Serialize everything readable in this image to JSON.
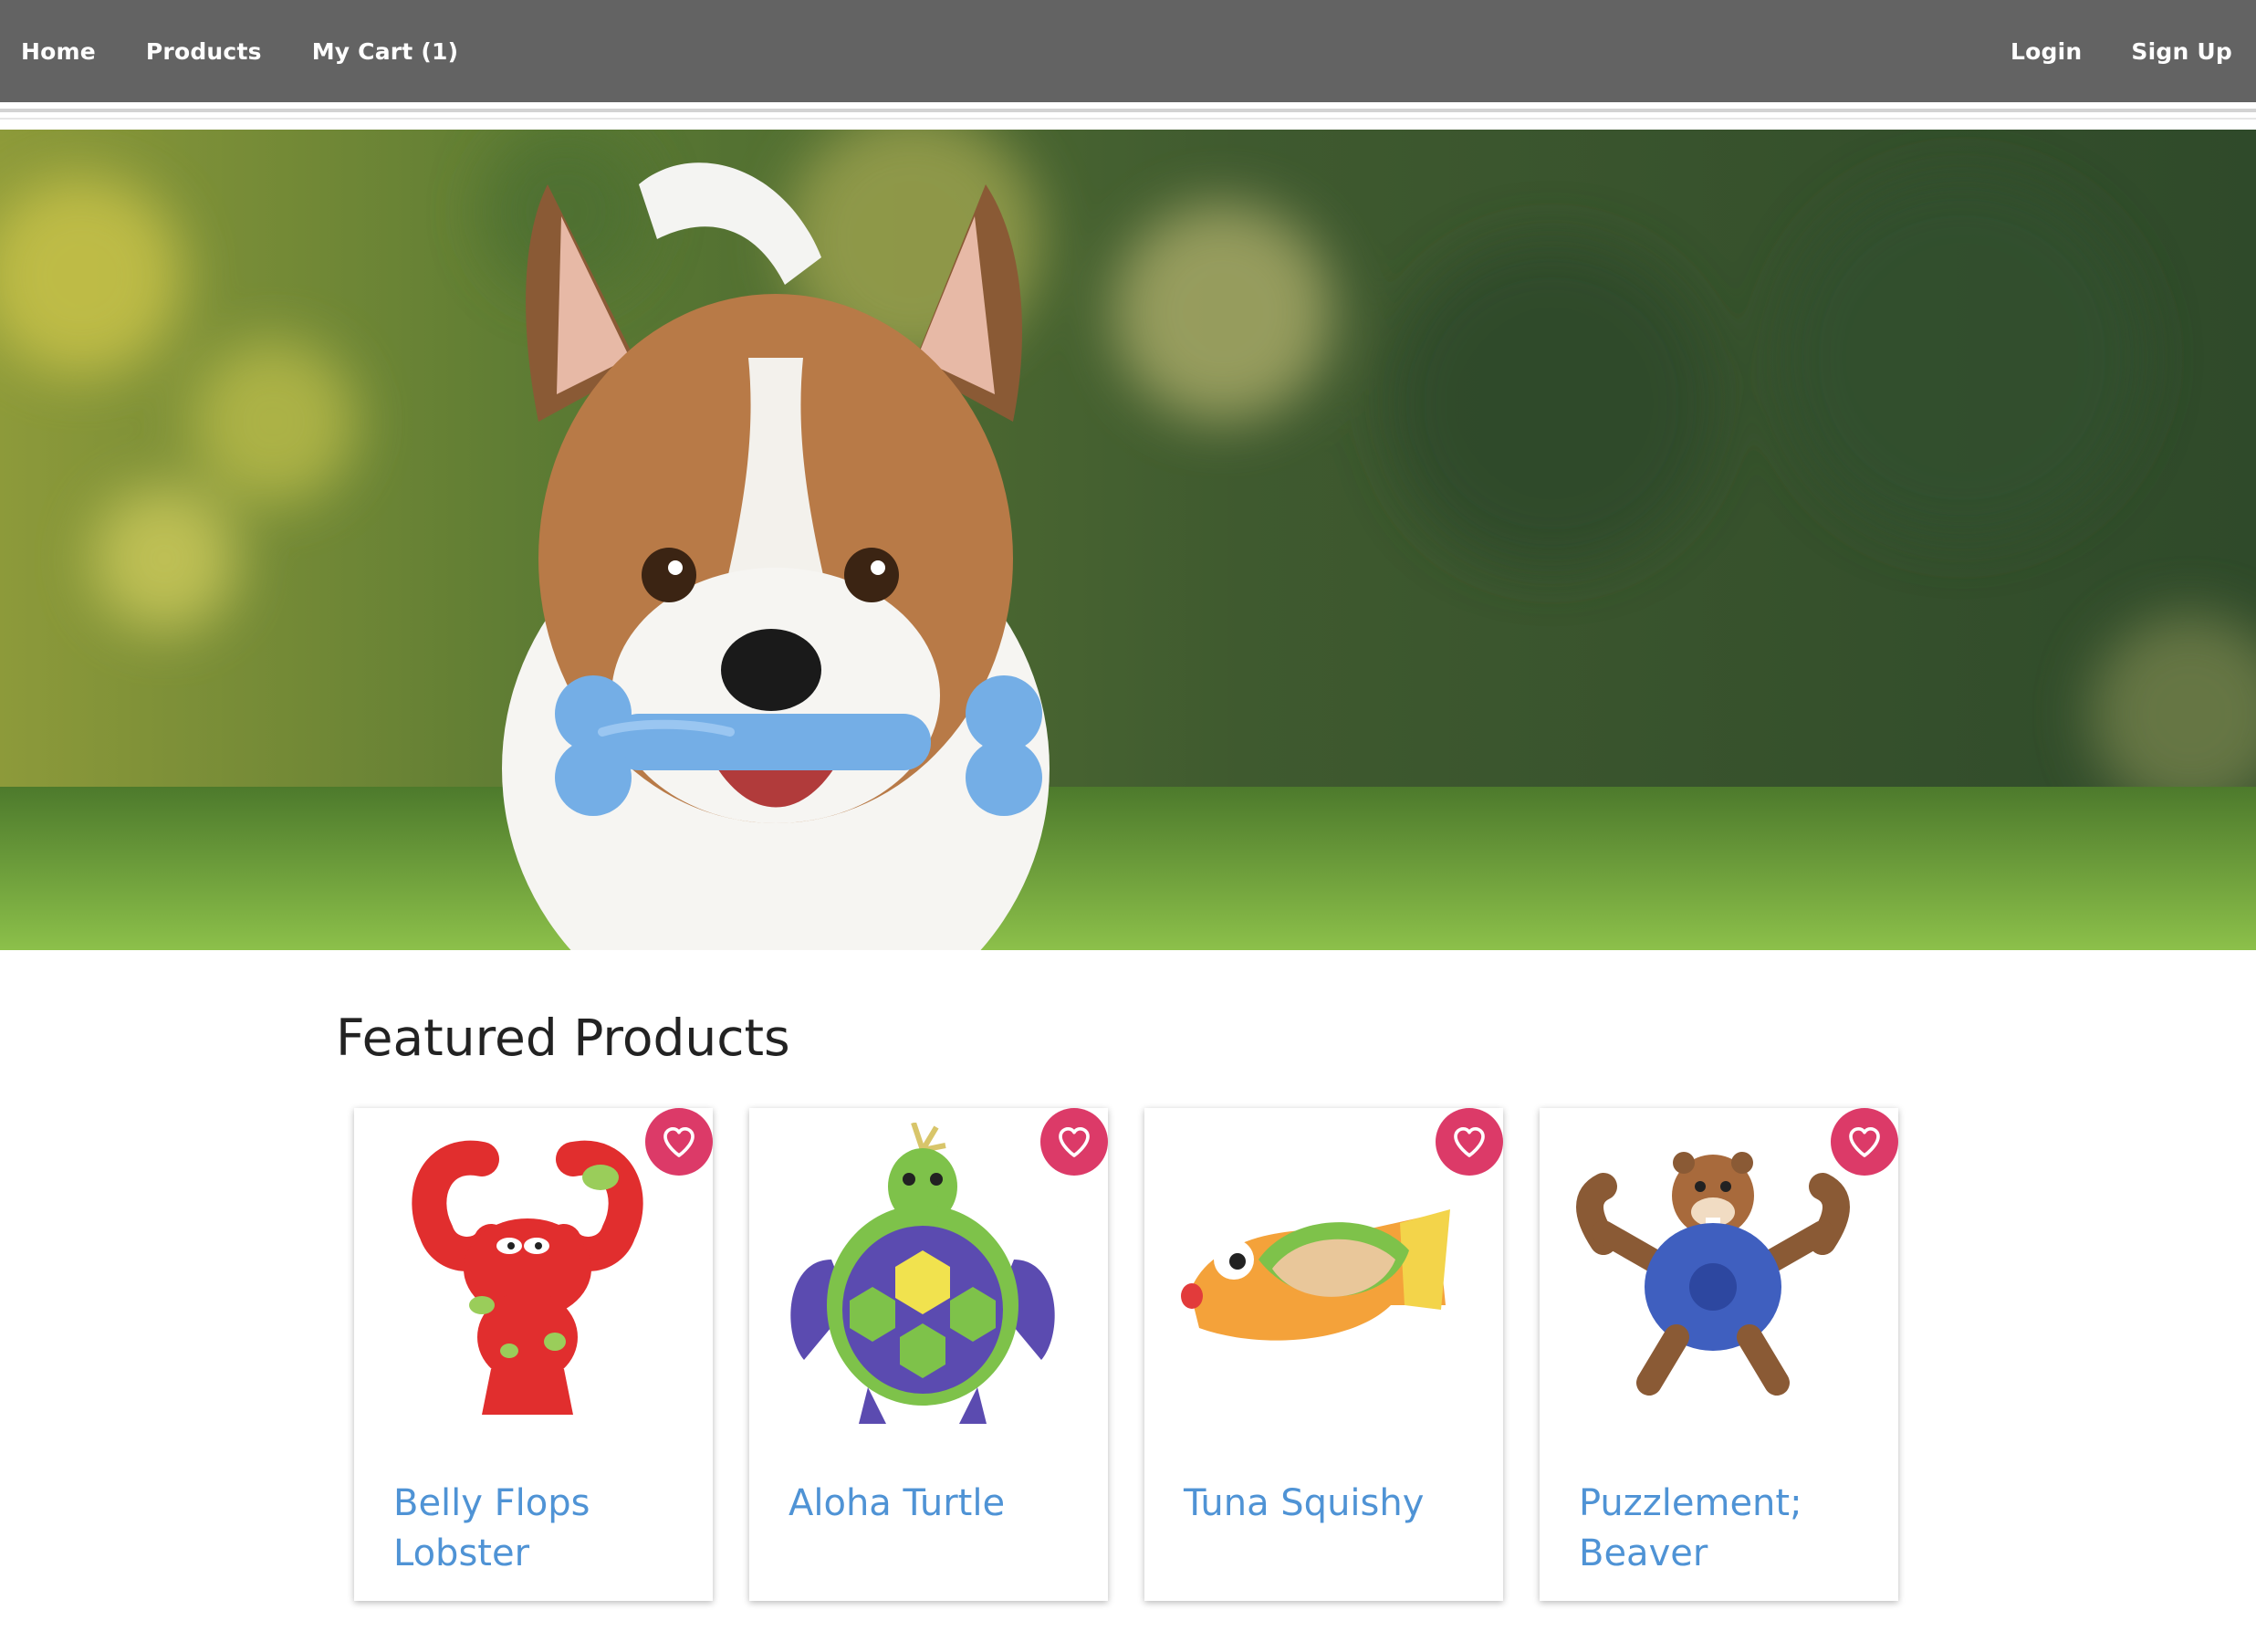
{
  "nav": {
    "left": [
      {
        "label": "Home"
      },
      {
        "label": "Products"
      },
      {
        "label": "My Cart (1)"
      }
    ],
    "right": [
      {
        "label": "Login"
      },
      {
        "label": "Sign Up"
      }
    ]
  },
  "hero": {
    "image": "dog-with-blue-bone-toy",
    "colors": {
      "foliage": "#3f5a2f",
      "grass": "#6fa63a",
      "toy": "#74aee6"
    }
  },
  "featured": {
    "title": "Featured Products",
    "favorite_icon": "heart-outline-icon",
    "favorite_color": "#dc3a68",
    "link_color": "#4f93d5",
    "products": [
      {
        "name": "Belly Flops Lobster",
        "image": "red-lobster-toy"
      },
      {
        "name": "Aloha Turtle",
        "image": "green-purple-turtle-toy"
      },
      {
        "name": "Tuna Squishy",
        "image": "fish-taco-toy"
      },
      {
        "name": "Puzzlement; Beaver",
        "image": "beaver-puzzle-toy"
      }
    ]
  }
}
